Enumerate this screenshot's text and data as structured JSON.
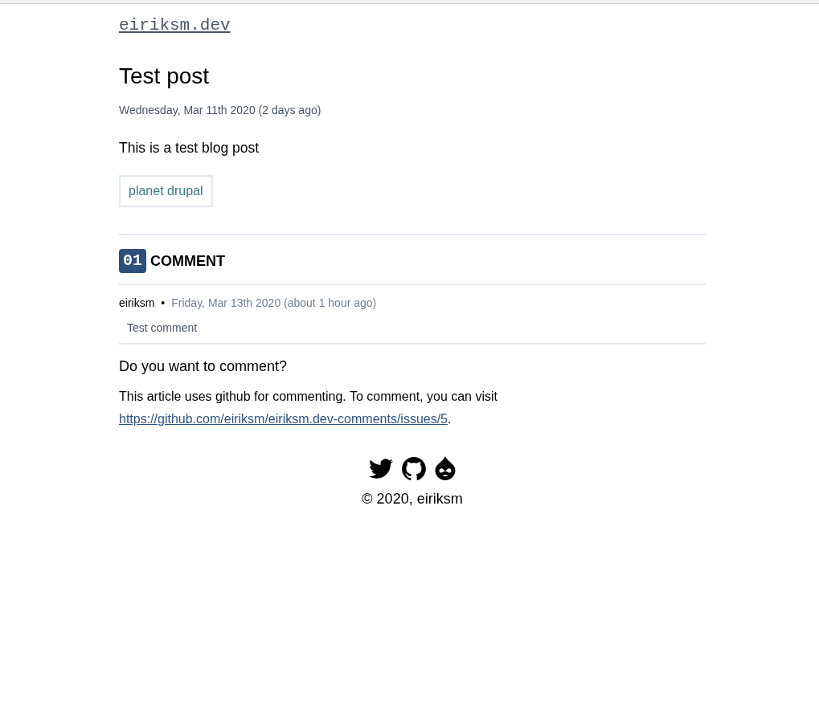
{
  "header": {
    "site_title": "eiriksm.dev"
  },
  "post": {
    "title": "Test post",
    "date": "Wednesday, Mar 11th 2020 (2 days ago)",
    "body": "This is a test blog post",
    "tags": [
      "planet drupal"
    ]
  },
  "comments": {
    "count": "01",
    "heading": "COMMENT",
    "items": [
      {
        "author": "eiriksm",
        "separator": "•",
        "date": "Friday, Mar 13th 2020 (about 1 hour ago)",
        "body": "Test comment"
      }
    ]
  },
  "comment_prompt": {
    "heading": "Do you want to comment?",
    "text": "This article uses github for commenting. To comment, you can visit",
    "link": "https://github.com/eiriksm/eiriksm.dev-comments/issues/5",
    "trailing": "."
  },
  "footer": {
    "copyright": "© 2020, eiriksm"
  }
}
